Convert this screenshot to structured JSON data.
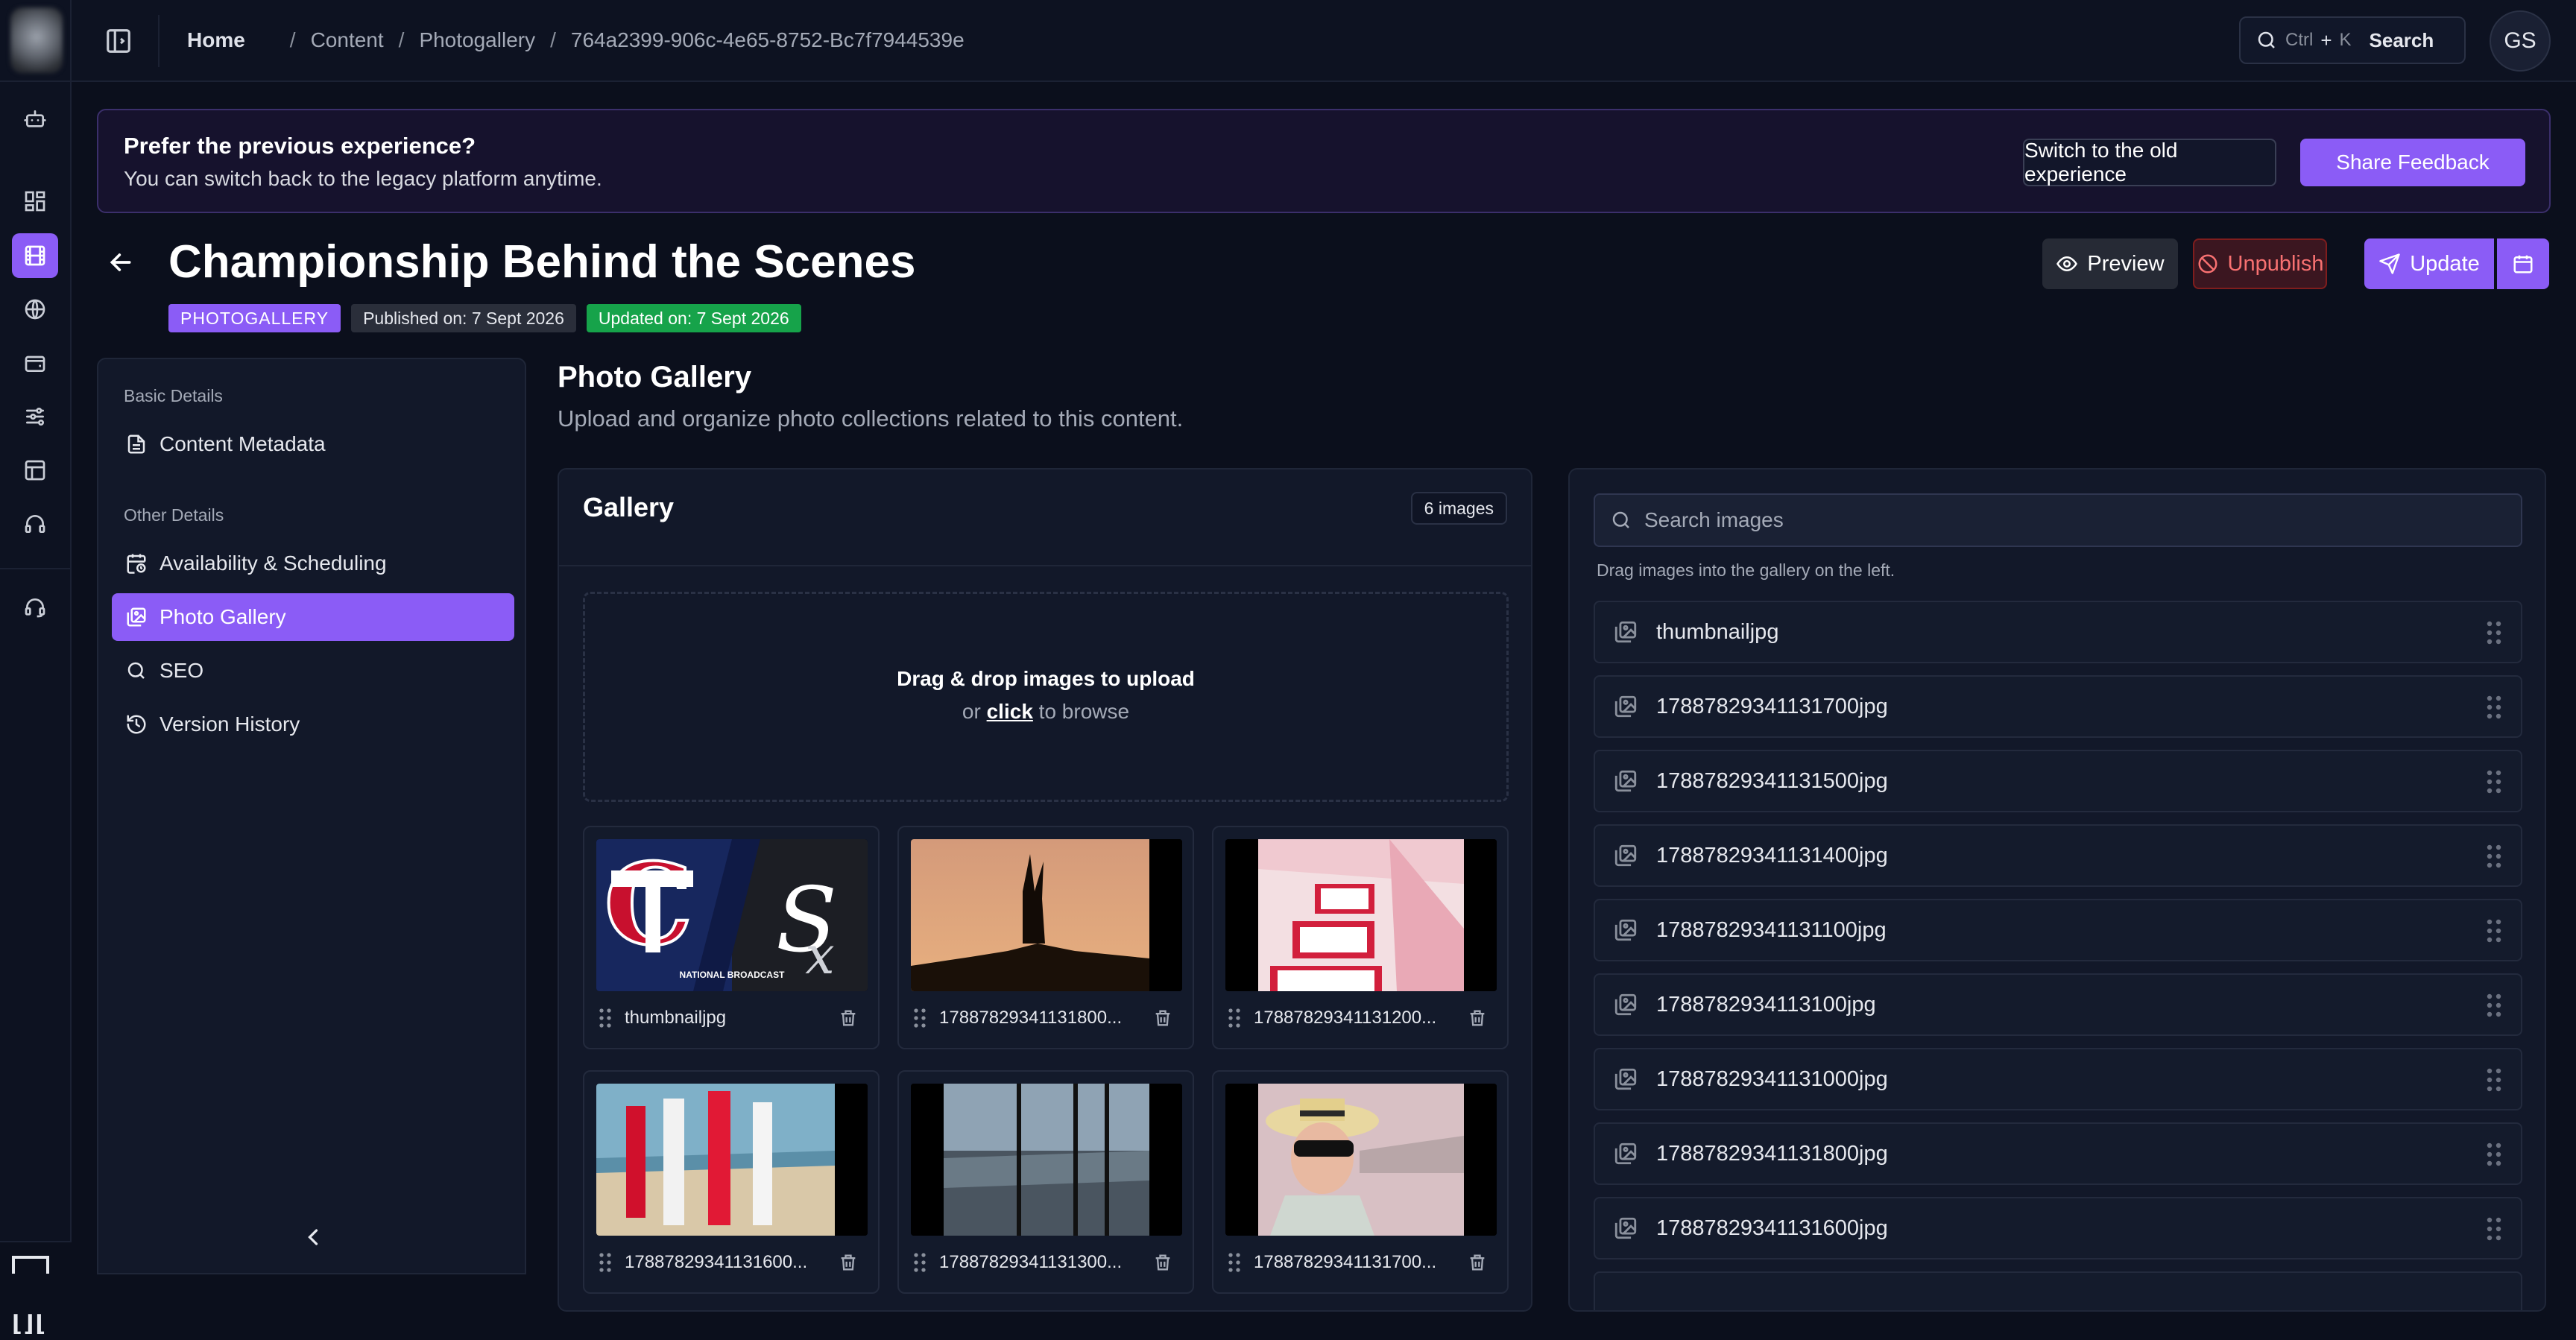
{
  "breadcrumbs": {
    "home": "Home",
    "items": [
      "Content",
      "Photogallery",
      "764a2399-906c-4e65-8752-Bc7f7944539e"
    ]
  },
  "search": {
    "key1": "Ctrl",
    "plus": "+",
    "key2": "K",
    "label": "Search"
  },
  "user": {
    "initials": "GS"
  },
  "banner": {
    "title": "Prefer the previous experience?",
    "subtitle": "You can switch back to the legacy platform anytime.",
    "switch_label": "Switch to the old experience",
    "feedback_label": "Share Feedback"
  },
  "page": {
    "title": "Championship Behind the Scenes",
    "type_badge": "PHOTOGALLERY",
    "published": "Published on: 7 Sept 2026",
    "updated": "Updated on: 7 Sept 2026"
  },
  "actions": {
    "preview": "Preview",
    "unpublish": "Unpublish",
    "update": "Update"
  },
  "nav": {
    "basic_group": "Basic Details",
    "other_group": "Other Details",
    "items": [
      {
        "label": "Content Metadata",
        "icon": "file-text-icon"
      },
      {
        "label": "Availability & Scheduling",
        "icon": "calendar-clock-icon"
      },
      {
        "label": "Photo Gallery",
        "icon": "images-icon"
      },
      {
        "label": "SEO",
        "icon": "search-icon"
      },
      {
        "label": "Version History",
        "icon": "history-icon"
      }
    ]
  },
  "section": {
    "title": "Photo Gallery",
    "subtitle": "Upload and organize photo collections related to this content."
  },
  "gallery": {
    "title": "Gallery",
    "count": "6 images",
    "drop_title": "Drag & drop images to upload",
    "drop_or": "or",
    "drop_click": "click",
    "drop_rest": "to browse",
    "images": [
      {
        "name": "thumbnailjpg"
      },
      {
        "name": "17887829341131800..."
      },
      {
        "name": "17887829341131200..."
      },
      {
        "name": "17887829341131600..."
      },
      {
        "name": "17887829341131300..."
      },
      {
        "name": "17887829341131700..."
      }
    ],
    "thumb_text": {
      "line1": "NATIONAL BROADCAST"
    }
  },
  "library": {
    "search_placeholder": "Search images",
    "hint": "Drag images into the gallery on the left.",
    "items": [
      "thumbnailjpg",
      "17887829341131700jpg",
      "17887829341131500jpg",
      "17887829341131400jpg",
      "17887829341131100jpg",
      "1788782934113100jpg",
      "17887829341131000jpg",
      "17887829341131800jpg",
      "17887829341131600jpg"
    ]
  },
  "colors": {
    "accent": "#8b5cf6",
    "success": "#16a34a",
    "danger": "#f87171",
    "background": "#0b0f1c"
  }
}
